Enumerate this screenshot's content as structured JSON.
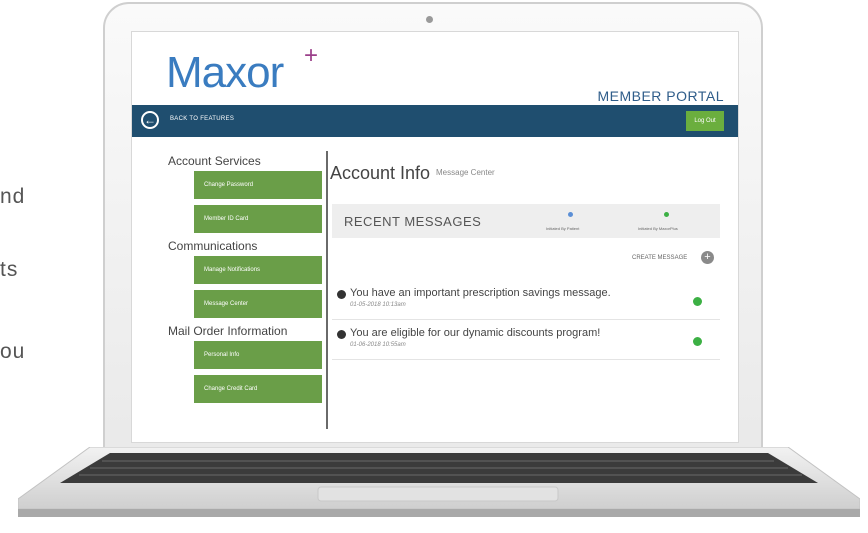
{
  "page_fragments": [
    "nd",
    "ts",
    "ou"
  ],
  "app": {
    "logo": "Maxor",
    "logo_mark": "+",
    "portal_title": "MEMBER PORTAL"
  },
  "nav": {
    "back_label": "BACK TO FEATURES",
    "logout_label": "Log Out"
  },
  "sidebar": {
    "sections": [
      {
        "title": "Account Services",
        "items": [
          "Change Password",
          "Member ID Card"
        ]
      },
      {
        "title": "Communications",
        "items": [
          "Manage Notifications",
          "Message Center"
        ]
      },
      {
        "title": "Mail Order Information",
        "items": [
          "Personal Info",
          "Change Credit Card"
        ]
      }
    ]
  },
  "main": {
    "title": "Account Info",
    "subtitle": "Message Center",
    "recent_title": "RECENT MESSAGES",
    "legend": [
      {
        "label": "Initiated By Patient",
        "color": "#5b8fd6"
      },
      {
        "label": "Initiated By MaxorPlus",
        "color": "#3cb044"
      }
    ],
    "create_label": "CREATE MESSAGE",
    "messages": [
      {
        "text": "You have an important prescription savings message.",
        "date": "01-05-2018 10:13am",
        "status_color": "#3cb044"
      },
      {
        "text": "You are eligible for our dynamic discounts program!",
        "date": "01-06-2018 10:55am",
        "status_color": "#3cb044"
      }
    ]
  },
  "colors": {
    "brand_blue": "#3a7cc0",
    "nav_bg": "#1f4e6f",
    "sidebar_btn": "#6a9e48",
    "logout_btn": "#6bae3e"
  }
}
